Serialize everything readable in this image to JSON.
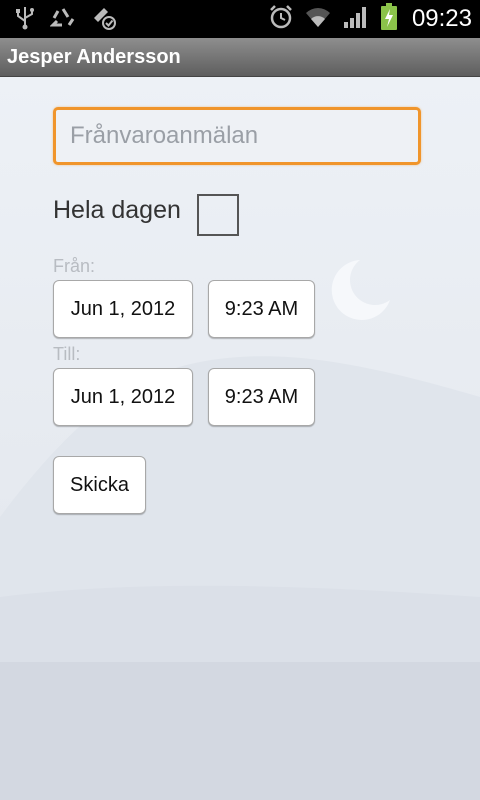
{
  "status_bar": {
    "time": "09:23",
    "icons_left": [
      "usb-icon",
      "recycle-icon",
      "phone-sync-icon"
    ],
    "icons_right": [
      "alarm-icon",
      "wifi-icon",
      "signal-icon",
      "battery-charging-icon"
    ],
    "colors": {
      "background": "#000000",
      "battery": "#8bc34a"
    }
  },
  "header": {
    "title": "Jesper Andersson"
  },
  "form": {
    "subject_placeholder": "Frånvaroanmälan",
    "subject_value": "",
    "all_day_label": "Hela dagen",
    "all_day_checked": false,
    "from_label": "Från:",
    "from_date": "Jun 1, 2012",
    "from_time": "9:23 AM",
    "to_label": "Till:",
    "to_date": "Jun 1, 2012",
    "to_time": "9:23 AM",
    "submit_label": "Skicka",
    "colors": {
      "focus_border": "#f0952b"
    }
  }
}
